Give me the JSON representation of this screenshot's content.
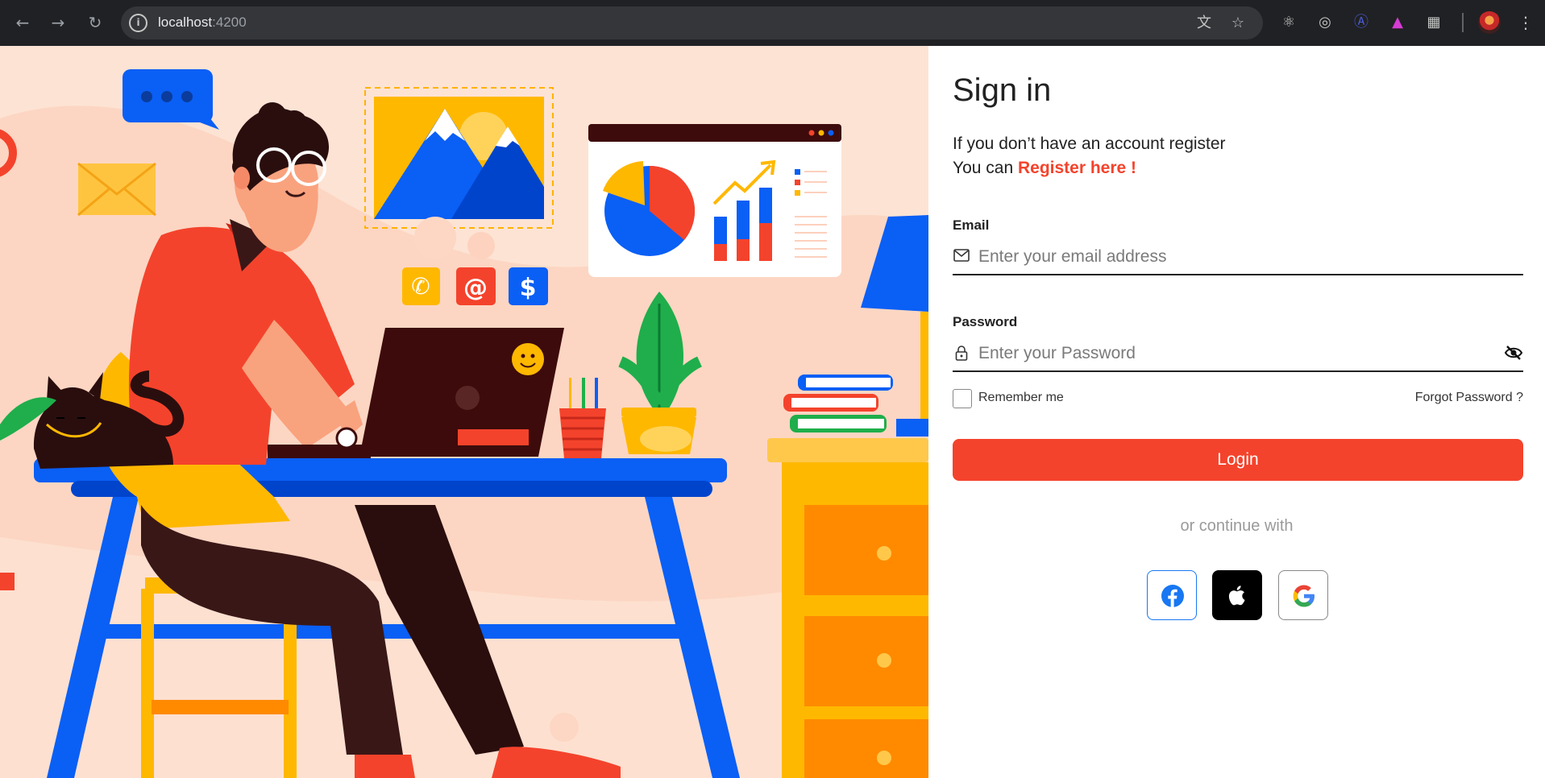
{
  "browser": {
    "url_host": "localhost",
    "url_port": ":4200"
  },
  "signin": {
    "title": "Sign in",
    "subtitle_line1": "If you don’t have an account register",
    "subtitle_line2_prefix": "You can ",
    "register_link": "Register here !",
    "email": {
      "label": "Email",
      "placeholder": "Enter your email address"
    },
    "password": {
      "label": "Password",
      "placeholder": "Enter your Password"
    },
    "remember_label": "Remember me",
    "forgot_label": "Forgot Password ?",
    "login_label": "Login",
    "or_continue": "or continue with"
  },
  "social": [
    {
      "name": "facebook"
    },
    {
      "name": "apple"
    },
    {
      "name": "google"
    }
  ],
  "colors": {
    "accent": "#f4432c",
    "illustration_bg": "#fde3d4",
    "facebook": "#1877f2"
  }
}
